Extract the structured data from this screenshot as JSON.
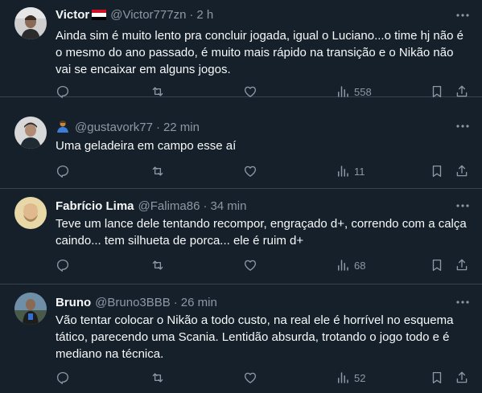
{
  "tweets": [
    {
      "name": "Victor",
      "handle": "@Victor777zn",
      "time": "2 h",
      "lines": [
        "Ainda sim é muito lento pra concluir jogada, igual o Luciano...o time hj não é",
        "o mesmo do ano passado, é muito mais rápido na transição e o Nikão não",
        "vai se encaixar em alguns jogos."
      ],
      "views": "558",
      "flag_colors": [
        "#ce1126",
        "#ffffff",
        "#000000"
      ]
    },
    {
      "name": "",
      "handle": "@gustavork77",
      "time": "22 min",
      "lines": [
        "Uma geladeira em campo esse aí"
      ],
      "views": "11"
    },
    {
      "name": "Fabrício Lima",
      "handle": "@Falima86",
      "time": "34 min",
      "lines": [
        "Teve um lance dele tentando recompor, engraçado d+, correndo com a calça",
        "caindo... tem silhueta de porca... ele é ruim d+"
      ],
      "views": "68"
    },
    {
      "name": "Bruno",
      "handle": "@Bruno3BBB",
      "time": "26 min",
      "lines": [
        "Vão tentar colocar o Nikão a todo custo, na real ele é horrível no esquema",
        "tático, parecendo uma Scania. Lentidão absurda, trotando o jogo todo e é",
        "mediano na técnica."
      ],
      "views": "52"
    }
  ],
  "separator": "·",
  "icons": {
    "more": "more-dots-icon",
    "reply": "reply-icon",
    "retweet": "retweet-icon",
    "like": "like-icon",
    "views": "views-icon",
    "bookmark": "bookmark-icon",
    "share": "share-icon"
  },
  "colors": {
    "background": "#15202b",
    "text": "#f7f9f9",
    "secondary": "#8b98a5",
    "border": "#38444d"
  }
}
